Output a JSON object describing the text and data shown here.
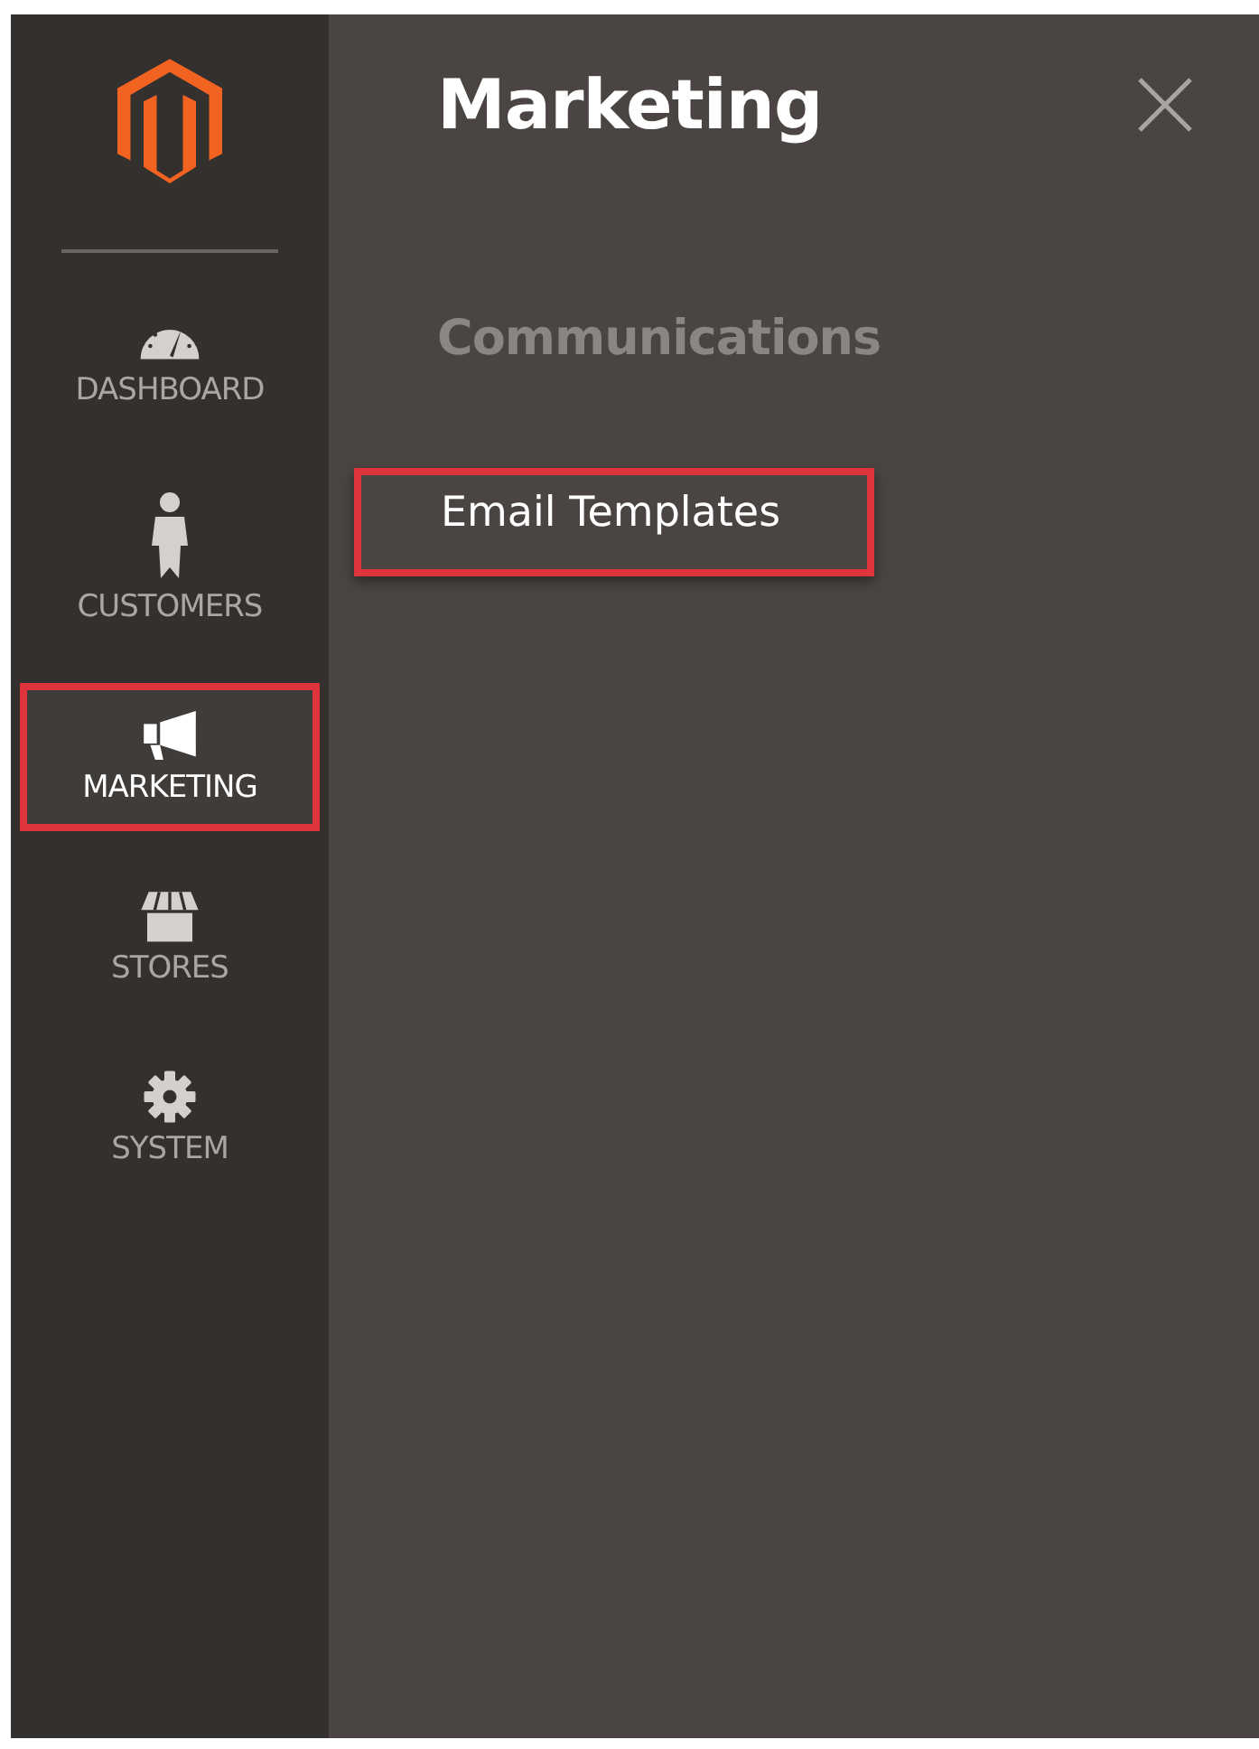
{
  "nav": {
    "items": [
      {
        "kind": "dashboard",
        "label": "DASHBOARD",
        "selected": false,
        "highlighted": false
      },
      {
        "kind": "customers",
        "label": "CUSTOMERS",
        "selected": false,
        "highlighted": false
      },
      {
        "kind": "marketing",
        "label": "MARKETING",
        "selected": true,
        "highlighted": true
      },
      {
        "kind": "stores",
        "label": "STORES",
        "selected": false,
        "highlighted": false
      },
      {
        "kind": "system",
        "label": "SYSTEM",
        "selected": false,
        "highlighted": false
      }
    ]
  },
  "submenu": {
    "title": "Marketing",
    "sections": [
      {
        "heading": "Communications",
        "links": [
          {
            "label": "Email Templates",
            "highlighted": true
          }
        ]
      }
    ]
  }
}
